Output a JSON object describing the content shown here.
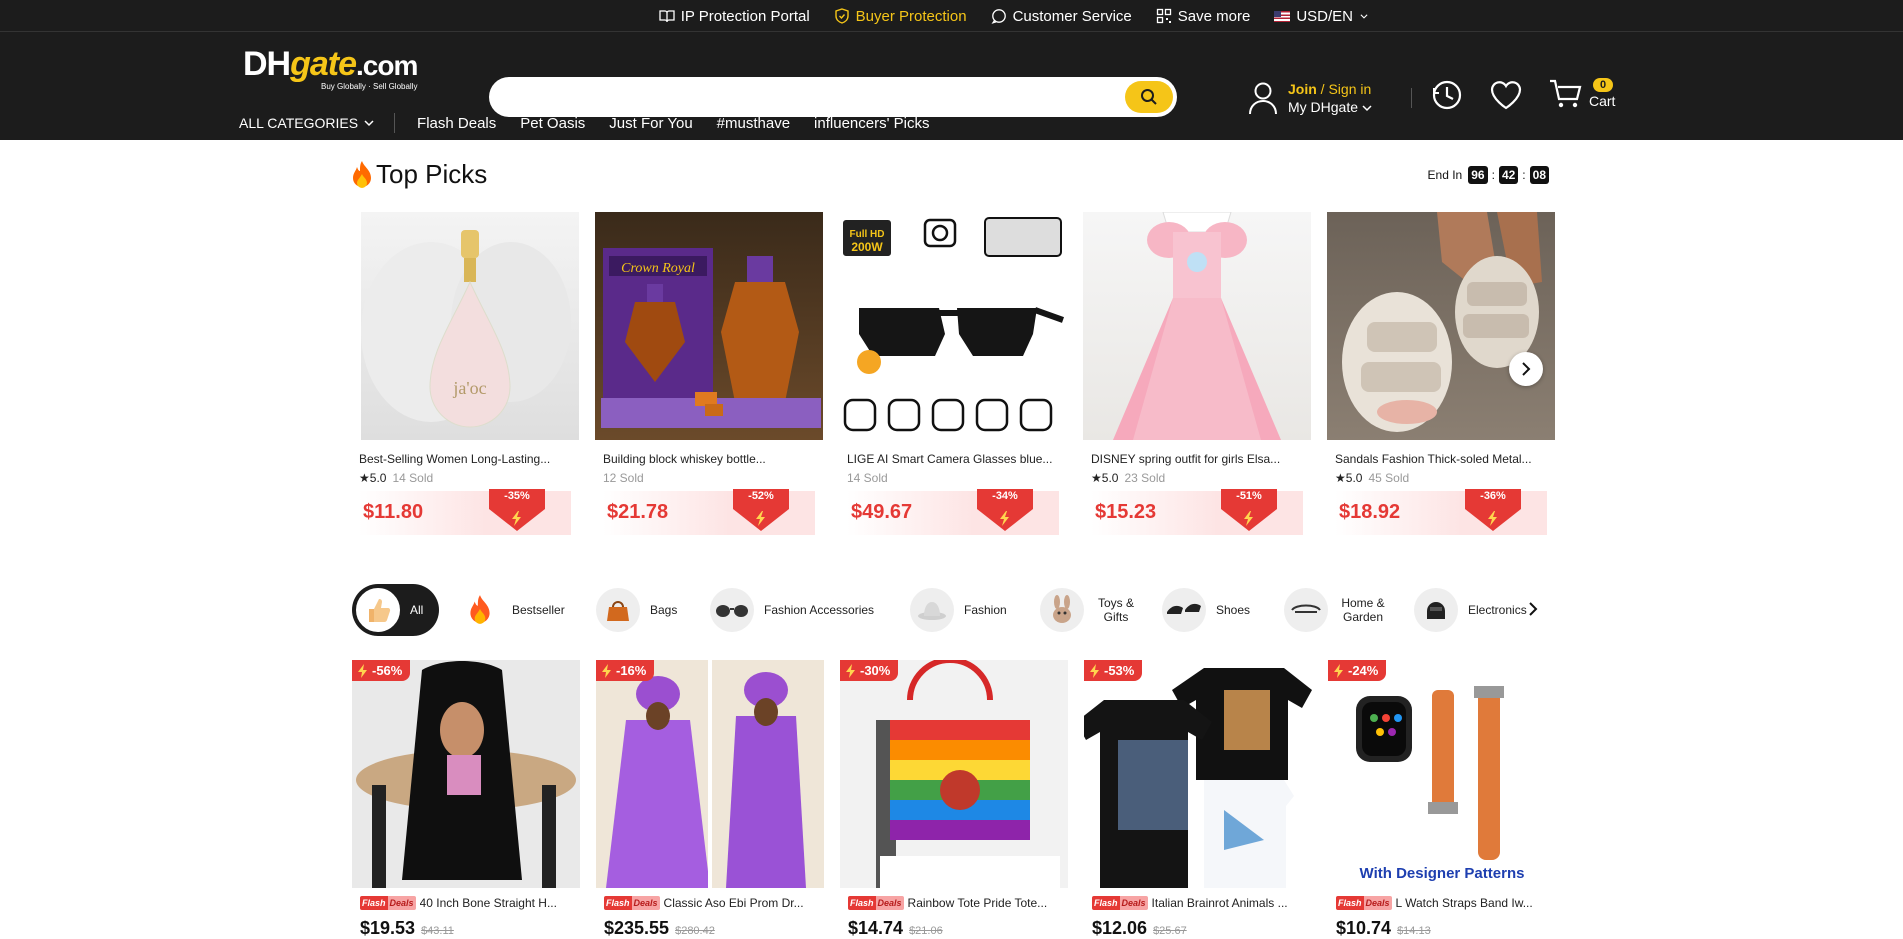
{
  "topbar": {
    "ip_protection": "IP Protection Portal",
    "buyer_protection": "Buyer Protection",
    "customer_service": "Customer Service",
    "save_more": "Save more",
    "currency": "USD/EN"
  },
  "header": {
    "logo": {
      "dh": "DH",
      "gate": "gate",
      "com": ".com",
      "tagline": "Buy Globally · Sell Globally"
    },
    "search": {
      "value": "",
      "placeholder": ""
    },
    "account": {
      "join": "Join",
      "sep": " / ",
      "signin": "Sign in",
      "my": "My DHgate"
    },
    "cart": {
      "label": "Cart",
      "count": "0"
    },
    "colors": {
      "accent": "#f5c518",
      "bg": "#1c1c1c"
    }
  },
  "nav": {
    "all_categories": "ALL CATEGORIES",
    "items": [
      "Flash Deals",
      "Pet Oasis",
      "Just For You",
      "#musthave",
      "influencers' Picks"
    ]
  },
  "top_picks": {
    "title": "Top Picks",
    "end_in": "End In",
    "timer": [
      "96",
      "42",
      "08"
    ],
    "items": [
      {
        "name": "Best-Selling Women Long-Lasting...",
        "rating": "5.0",
        "sold": "14 Sold",
        "price": "$11.80",
        "discount": "-35%",
        "image": "perfume bottle"
      },
      {
        "name": "Building block whiskey bottle...",
        "rating": "",
        "sold": "12 Sold",
        "price": "$21.78",
        "discount": "-52%",
        "image": "whiskey building blocks"
      },
      {
        "name": "LIGE AI Smart Camera Glasses blue...",
        "rating": "",
        "sold": "14 Sold",
        "price": "$49.67",
        "discount": "-34%",
        "image": "smart glasses",
        "img_label": "Full HD 200W"
      },
      {
        "name": "DISNEY spring outfit for girls Elsa...",
        "rating": "5.0",
        "sold": "23 Sold",
        "price": "$15.23",
        "discount": "-51%",
        "image": "pink dress"
      },
      {
        "name": "Sandals Fashion Thick-soled Metal...",
        "rating": "5.0",
        "sold": "45 Sold",
        "price": "$18.92",
        "discount": "-36%",
        "image": "sandals"
      }
    ]
  },
  "categories": [
    {
      "label": "All",
      "icon": "thumbs-up"
    },
    {
      "label": "Bestseller",
      "icon": "fire"
    },
    {
      "label": "Bags",
      "icon": "bag"
    },
    {
      "label": "Fashion Accessories",
      "icon": "sunglasses"
    },
    {
      "label": "Fashion",
      "icon": "hat"
    },
    {
      "label": "Toys & Gifts",
      "icon": "toy"
    },
    {
      "label": "Shoes",
      "icon": "shoes"
    },
    {
      "label": "Home & Garden",
      "icon": "home"
    },
    {
      "label": "Electronics",
      "icon": "electronics"
    }
  ],
  "flash_deal_tag": {
    "a": "Flash",
    "b": "Deals"
  },
  "products": [
    {
      "discount": "-56%",
      "title": "40 Inch Bone Straight H...",
      "price": "$19.53",
      "old": "$43.11"
    },
    {
      "discount": "-16%",
      "title": "Classic Aso Ebi Prom Dr...",
      "price": "$235.55",
      "old": "$280.42"
    },
    {
      "discount": "-30%",
      "title": "Rainbow Tote Pride Tote...",
      "price": "$14.74",
      "old": "$21.06"
    },
    {
      "discount": "-53%",
      "title": "Italian Brainrot Animals ...",
      "price": "$12.06",
      "old": "$25.67"
    },
    {
      "discount": "-24%",
      "title": "L Watch Straps Band Iw...",
      "price": "$10.74",
      "old": "$14.13",
      "img_text": "With Designer Patterns"
    }
  ]
}
